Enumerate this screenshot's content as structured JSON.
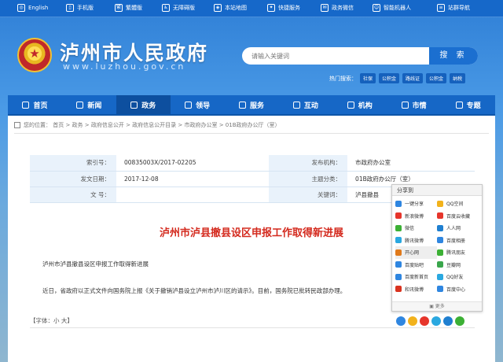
{
  "topbar": [
    {
      "icon": "globe-icon",
      "label": "English"
    },
    {
      "icon": "mobile-icon",
      "label": "手机版"
    },
    {
      "icon": "traditional-icon",
      "label": "繁體版"
    },
    {
      "icon": "accessibility-icon",
      "label": "无障碍版"
    },
    {
      "icon": "map-icon",
      "label": "本站地图"
    },
    {
      "icon": "fast-service-icon",
      "label": "快捷服务"
    },
    {
      "icon": "wechat-icon",
      "label": "政务微信"
    },
    {
      "icon": "robot-icon",
      "label": "智能机器人"
    },
    {
      "icon": "site-nav-icon",
      "label": "站群导航"
    }
  ],
  "header": {
    "title": "泸州市人民政府",
    "url": "www.luzhou.gov.cn",
    "search_placeholder": "请输入关键词",
    "search_button": "搜 索",
    "hot_label": "热门搜索：",
    "hot_tags": [
      "社保",
      "公积金",
      "路线证",
      "公积金",
      "纳税"
    ]
  },
  "nav": [
    {
      "icon": "home-icon",
      "label": "首页"
    },
    {
      "icon": "news-icon",
      "label": "新闻"
    },
    {
      "icon": "government-icon",
      "label": "政务"
    },
    {
      "icon": "leader-icon",
      "label": "领导"
    },
    {
      "icon": "service-icon",
      "label": "服务"
    },
    {
      "icon": "interaction-icon",
      "label": "互动"
    },
    {
      "icon": "institution-icon",
      "label": "机构"
    },
    {
      "icon": "city-icon",
      "label": "市情"
    },
    {
      "icon": "topic-icon",
      "label": "专题"
    }
  ],
  "breadcrumb": "您的位置：  首页  >  政务  >  政府信息公开  >  政府信息公开目录  >  市政府办公室  >  01B政府办公厅（室）",
  "meta": {
    "index_label": "索引号：",
    "index_value": "00835003X/2017-02205",
    "org_label": "发布机构：",
    "org_value": "市政府办公室",
    "date_label": "发文日期：",
    "date_value": "2017-12-08",
    "category_label": "主题分类：",
    "category_value": "01B政府办公厅（室）",
    "doc_label": "文  号：",
    "doc_value": "",
    "keyword_label": "关键词：",
    "keyword_value": "泸县撤县"
  },
  "article": {
    "title": "泸州市泸县撤县设区申报工作取得新进展",
    "subtitle": "泸州市泸县撤县设区申报工作取得新进展",
    "body": "近日，省政府以正式文件向国务院上报《关于撤销泸县设立泸州市泸川区的请示》。目前，国务院已批转民政部办理。",
    "font_size": "【字体：小 大】"
  },
  "share": {
    "header": "分享到",
    "items": [
      "一键分享",
      "QQ空间",
      "新浪微博",
      "百度云收藏",
      "微信",
      "人人网",
      "腾讯微博",
      "百度相册",
      "开心网",
      "腾讯朋友",
      "百度贴吧",
      "豆瓣网",
      "百度新首页",
      "QQ好友",
      "和讯微博",
      "百度中心"
    ],
    "more": "更多"
  },
  "colors": {
    "brand_blue": "#1667c6",
    "title_red": "#d42a1e"
  }
}
